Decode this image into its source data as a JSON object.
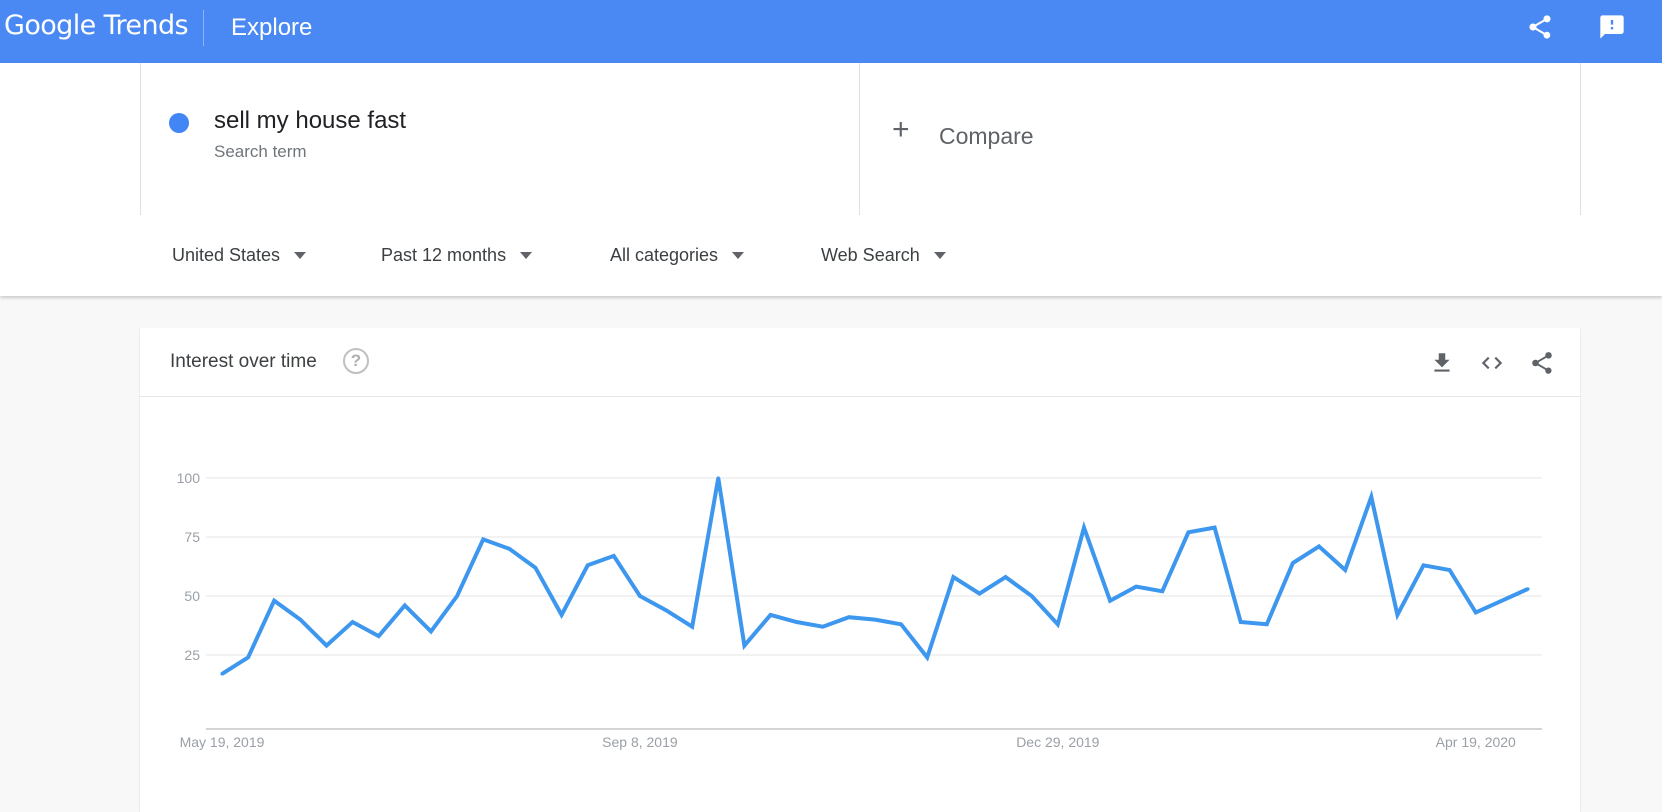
{
  "header": {
    "logo_text": "Google Trends",
    "section": "Explore",
    "share_icon": "share-icon",
    "feedback_icon": "feedback-icon",
    "background_color": "#4a89f3"
  },
  "search": {
    "term": "sell my house fast",
    "term_type": "Search term",
    "term_color": "#4285f4",
    "compare_label": "Compare"
  },
  "filters": [
    {
      "label": "United States"
    },
    {
      "label": "Past 12 months"
    },
    {
      "label": "All categories"
    },
    {
      "label": "Web Search"
    }
  ],
  "card": {
    "title": "Interest over time",
    "help_glyph": "?",
    "actions": [
      "download-icon",
      "embed-code-icon",
      "share-icon"
    ]
  },
  "chart_data": {
    "type": "line",
    "x_tick_labels": [
      "May 19, 2019",
      "Sep 8, 2019",
      "Dec 29, 2019",
      "Apr 19, 2020"
    ],
    "x_tick_indices": [
      0,
      16,
      32,
      48
    ],
    "y_ticks": [
      25,
      50,
      75,
      100
    ],
    "ylim": [
      0,
      100
    ],
    "grid": true,
    "line_color": "#3e97ee",
    "series": [
      {
        "values": [
          17,
          24,
          48,
          40,
          29,
          39,
          33,
          46,
          35,
          50,
          74,
          70,
          62,
          42,
          63,
          67,
          50,
          44,
          37,
          100,
          29,
          42,
          39,
          37,
          41,
          40,
          38,
          24,
          58,
          51,
          58,
          50,
          38,
          79,
          48,
          54,
          52,
          77,
          79,
          39,
          38,
          64,
          71,
          61,
          92,
          42,
          63,
          61,
          43,
          48,
          53
        ]
      }
    ]
  }
}
